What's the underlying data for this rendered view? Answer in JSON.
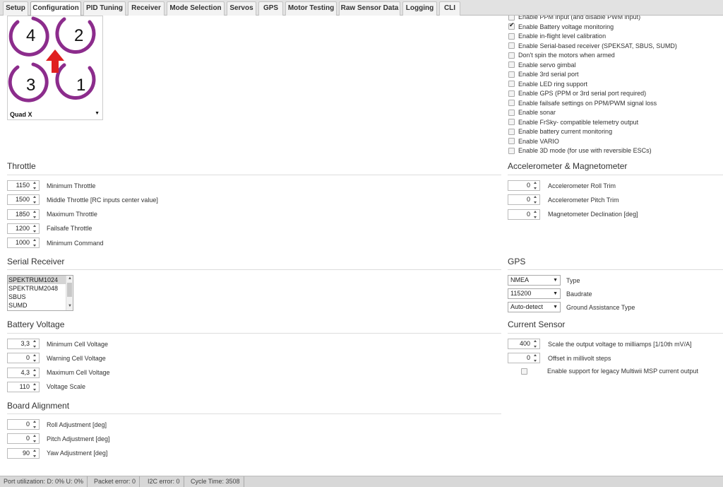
{
  "tabs": [
    {
      "label": "Setup",
      "active": false
    },
    {
      "label": "Configuration",
      "active": true
    },
    {
      "label": "PID Tuning",
      "active": false
    },
    {
      "label": "Receiver",
      "active": false
    },
    {
      "label": "Mode Selection",
      "active": false
    },
    {
      "label": "Servos",
      "active": false
    },
    {
      "label": "GPS",
      "active": false
    },
    {
      "label": "Motor Testing",
      "active": false
    },
    {
      "label": "Raw Sensor Data",
      "active": false
    },
    {
      "label": "Logging",
      "active": false
    },
    {
      "label": "CLI",
      "active": false
    }
  ],
  "mixer": {
    "motors": [
      "4",
      "2",
      "3",
      "1"
    ],
    "selected": "Quad X",
    "ring_color": "#8c2c8c",
    "arrow_color": "#e02020"
  },
  "features": [
    {
      "label": "Enable PPM input (and disable PWM input)",
      "checked": false
    },
    {
      "label": "Enable Battery voltage monitoring",
      "checked": true
    },
    {
      "label": "Enable in-flight level calibration",
      "checked": false
    },
    {
      "label": "Enable Serial-based receiver (SPEKSAT, SBUS, SUMD)",
      "checked": false
    },
    {
      "label": "Don't spin the motors when armed",
      "checked": false
    },
    {
      "label": "Enable servo gimbal",
      "checked": false
    },
    {
      "label": "Enable 3rd serial port",
      "checked": false
    },
    {
      "label": "Enable LED ring support",
      "checked": false
    },
    {
      "label": "Enable GPS (PPM or 3rd serial port required)",
      "checked": false
    },
    {
      "label": "Enable failsafe settings on PPM/PWM signal loss",
      "checked": false
    },
    {
      "label": "Enable sonar",
      "checked": false
    },
    {
      "label": "Enable FrSky- compatible telemetry output",
      "checked": false
    },
    {
      "label": "Enable battery current monitoring",
      "checked": false
    },
    {
      "label": "Enable VARIO",
      "checked": false
    },
    {
      "label": "Enable 3D mode (for use with reversible ESCs)",
      "checked": false
    }
  ],
  "throttle": {
    "title": "Throttle",
    "fields": [
      {
        "value": "1150",
        "label": "Minimum Throttle"
      },
      {
        "value": "1500",
        "label": "Middle Throttle [RC inputs center value]"
      },
      {
        "value": "1850",
        "label": "Maximum Throttle"
      },
      {
        "value": "1200",
        "label": "Failsafe Throttle"
      },
      {
        "value": "1000",
        "label": "Minimum Command"
      }
    ]
  },
  "accel": {
    "title": "Accelerometer & Magnetometer",
    "fields": [
      {
        "value": "0",
        "label": "Accelerometer Roll Trim"
      },
      {
        "value": "0",
        "label": "Accelerometer Pitch Trim"
      },
      {
        "value": "0",
        "label": "Magnetometer Declination [deg]"
      }
    ]
  },
  "serial_receiver": {
    "title": "Serial Receiver",
    "options": [
      "SPEKTRUM1024",
      "SPEKTRUM2048",
      "SBUS",
      "SUMD"
    ],
    "selected_index": 0
  },
  "gps": {
    "title": "GPS",
    "fields": [
      {
        "value": "NMEA",
        "label": "Type"
      },
      {
        "value": "115200",
        "label": "Baudrate"
      },
      {
        "value": "Auto-detect",
        "label": "Ground Assistance Type"
      }
    ]
  },
  "battery": {
    "title": "Battery Voltage",
    "fields": [
      {
        "value": "3,3",
        "label": "Minimum Cell Voltage"
      },
      {
        "value": "0",
        "label": "Warning Cell Voltage"
      },
      {
        "value": "4,3",
        "label": "Maximum Cell Voltage"
      },
      {
        "value": "110",
        "label": "Voltage Scale"
      }
    ]
  },
  "current": {
    "title": "Current Sensor",
    "fields": [
      {
        "value": "400",
        "label": "Scale the output voltage to milliamps [1/10th mV/A]"
      },
      {
        "value": "0",
        "label": "Offset in millivolt steps"
      }
    ],
    "legacy_label": "Enable support for legacy Multiwii MSP current output",
    "legacy_checked": false
  },
  "board": {
    "title": "Board Alignment",
    "fields": [
      {
        "value": "0",
        "label": "Roll Adjustment [deg]"
      },
      {
        "value": "0",
        "label": "Pitch Adjustment [deg]"
      },
      {
        "value": "90",
        "label": "Yaw Adjustment [deg]"
      }
    ]
  },
  "status": {
    "port": "Port utilization: D: 0% U: 0%",
    "packet": "Packet error: 0",
    "i2c": "I2C error: 0",
    "cycle": "Cycle Time: 3508"
  }
}
